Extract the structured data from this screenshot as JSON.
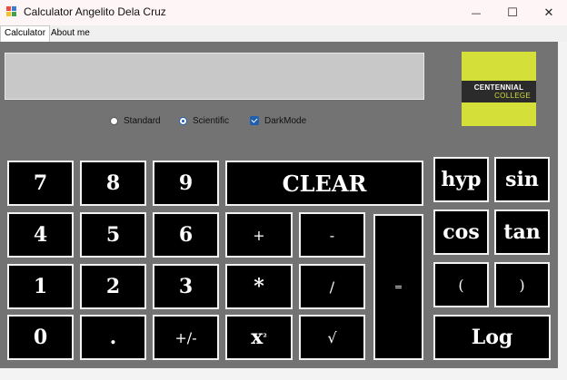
{
  "window": {
    "title": "Calculator Angelito Dela Cruz",
    "controls": {
      "minimize": "—",
      "maximize": "☐",
      "close": "✕"
    }
  },
  "tabs": [
    {
      "label": "Calculator",
      "active": true
    },
    {
      "label": "About me",
      "active": false
    }
  ],
  "display": {
    "value": ""
  },
  "logo": {
    "line1": "CENTENNIAL",
    "line2": "COLLEGE"
  },
  "modes": {
    "standard": {
      "label": "Standard",
      "selected": false
    },
    "scientific": {
      "label": "Scientific",
      "selected": true
    },
    "darkmode": {
      "label": "DarkMode",
      "checked": true
    }
  },
  "keys": {
    "k7": "7",
    "k8": "8",
    "k9": "9",
    "clear": "CLEAR",
    "k4": "4",
    "k5": "5",
    "k6": "6",
    "plus": "+",
    "minus": "-",
    "k1": "1",
    "k2": "2",
    "k3": "3",
    "multiply": "*",
    "divide": "/",
    "k0": "0",
    "dot": ".",
    "sign": "+/-",
    "square_base": "x",
    "square_exp": "²",
    "sqrt": "√",
    "equals": "=",
    "hyp": "hyp",
    "sin": "sin",
    "cos": "cos",
    "tan": "tan",
    "lparen": "(",
    "rparen": ")",
    "log": "Log"
  },
  "colors": {
    "panel": "#737373",
    "key_bg": "#000000",
    "key_border": "#f2f2f2",
    "display_bg": "#c8c8c8",
    "logo_green": "#d4df3a",
    "accent": "#1f5fb0"
  }
}
